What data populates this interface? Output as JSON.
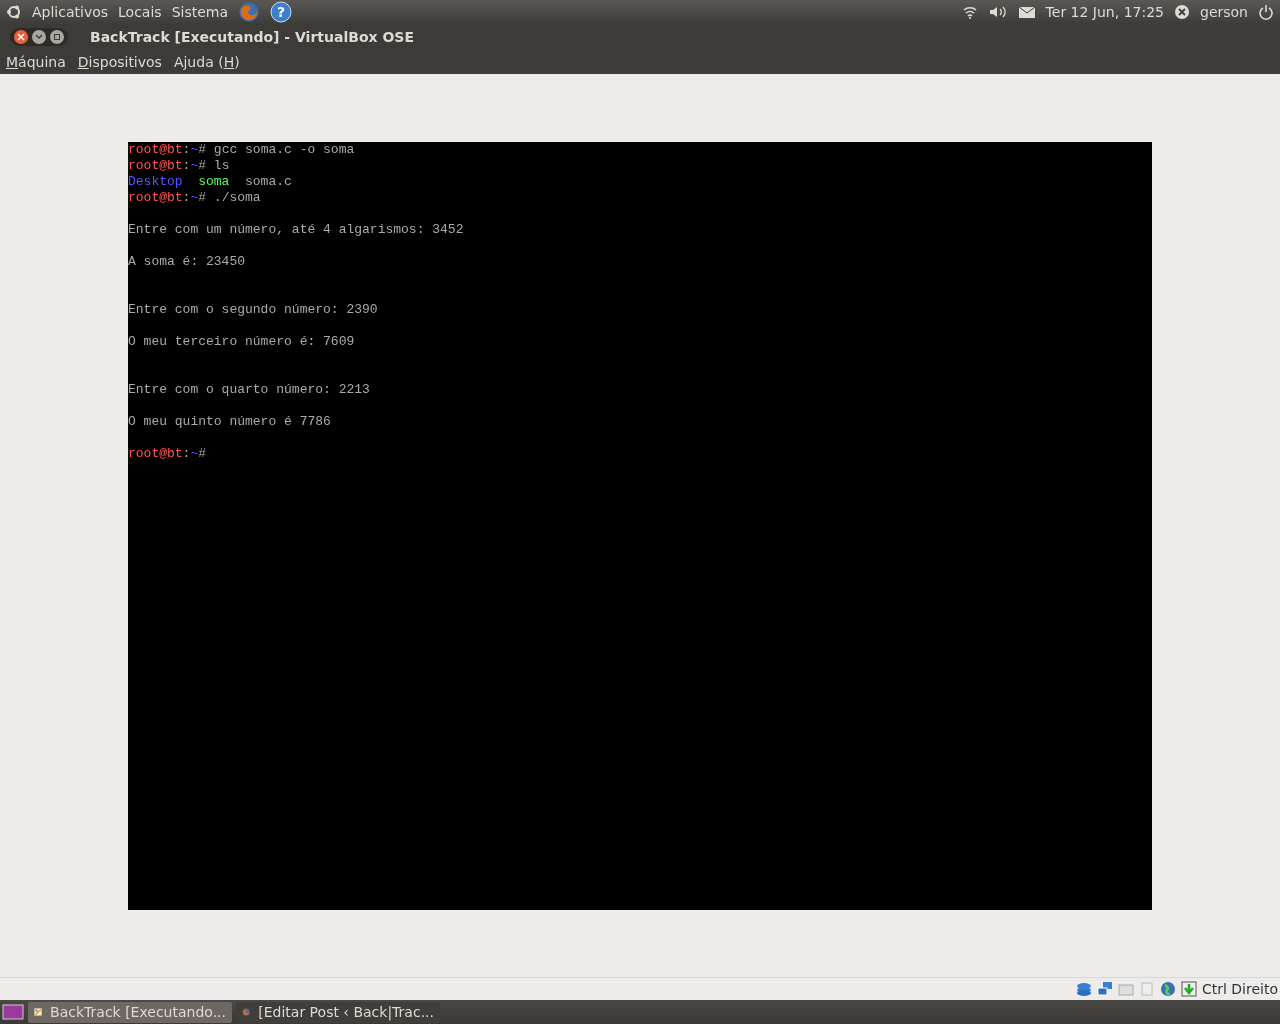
{
  "top_panel": {
    "menus": [
      "Aplicativos",
      "Locais",
      "Sistema"
    ],
    "help_glyph": "?",
    "clock": "Ter 12 Jun, 17:25",
    "user": "gerson"
  },
  "window": {
    "title": "BackTrack [Executando] - VirtualBox OSE"
  },
  "menu_bar": [
    {
      "parts": [
        {
          "text": "M",
          "underlined": true
        },
        {
          "text": "áquina",
          "underlined": false
        }
      ]
    },
    {
      "parts": [
        {
          "text": "D",
          "underlined": true
        },
        {
          "text": "ispositivos",
          "underlined": false
        }
      ]
    },
    {
      "parts": [
        {
          "text": "Ajuda (",
          "underlined": false
        },
        {
          "text": "H",
          "underlined": true
        },
        {
          "text": ")",
          "underlined": false
        }
      ]
    }
  ],
  "terminal": {
    "lines": [
      {
        "kind": "text",
        "segments": [
          {
            "kind": "prompt",
            "text": "root@bt"
          },
          {
            "kind": "text",
            "text": ":"
          },
          {
            "kind": "path",
            "text": "~"
          },
          {
            "kind": "text",
            "text": "# gcc soma.c -o soma"
          }
        ]
      },
      {
        "kind": "text",
        "segments": [
          {
            "kind": "prompt",
            "text": "root@bt"
          },
          {
            "kind": "text",
            "text": ":"
          },
          {
            "kind": "path",
            "text": "~"
          },
          {
            "kind": "text",
            "text": "# ls"
          }
        ]
      },
      {
        "kind": "listing",
        "segments": [
          {
            "kind": "dir",
            "text": "Desktop"
          },
          {
            "kind": "exec",
            "text": "soma"
          },
          {
            "kind": "text",
            "text": "soma.c"
          }
        ]
      },
      {
        "kind": "text",
        "segments": [
          {
            "kind": "prompt",
            "text": "root@bt"
          },
          {
            "kind": "text",
            "text": ":"
          },
          {
            "kind": "path",
            "text": "~"
          },
          {
            "kind": "text",
            "text": "# ./soma"
          }
        ]
      },
      {
        "kind": "blank"
      },
      {
        "kind": "text",
        "segments": [
          {
            "kind": "text",
            "text": "Entre com um número, até 4 algarismos: 3452"
          }
        ]
      },
      {
        "kind": "blank"
      },
      {
        "kind": "text",
        "segments": [
          {
            "kind": "text",
            "text": "A soma é: 23450"
          }
        ]
      },
      {
        "kind": "blank"
      },
      {
        "kind": "blank"
      },
      {
        "kind": "text",
        "segments": [
          {
            "kind": "text",
            "text": "Entre com o segundo número: 2390"
          }
        ]
      },
      {
        "kind": "blank"
      },
      {
        "kind": "text",
        "segments": [
          {
            "kind": "text",
            "text": "O meu terceiro número é: 7609"
          }
        ]
      },
      {
        "kind": "blank"
      },
      {
        "kind": "blank"
      },
      {
        "kind": "text",
        "segments": [
          {
            "kind": "text",
            "text": "Entre com o quarto número: 2213"
          }
        ]
      },
      {
        "kind": "blank"
      },
      {
        "kind": "text",
        "segments": [
          {
            "kind": "text",
            "text": "O meu quinto número é 7786"
          }
        ]
      },
      {
        "kind": "blank"
      },
      {
        "kind": "text",
        "segments": [
          {
            "kind": "prompt",
            "text": "root@bt"
          },
          {
            "kind": "text",
            "text": ":"
          },
          {
            "kind": "path",
            "text": "~"
          },
          {
            "kind": "text",
            "text": "#"
          }
        ]
      }
    ]
  },
  "status_bar": {
    "host_key": "Ctrl Direito"
  },
  "taskbar": [
    {
      "label": "BackTrack [Executando...",
      "kind": "vbox",
      "selected": true
    },
    {
      "label": "[Editar Post ‹ Back|Trac...",
      "kind": "browser",
      "selected": false
    }
  ]
}
